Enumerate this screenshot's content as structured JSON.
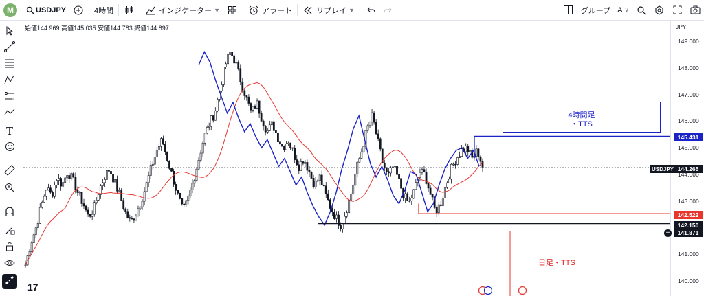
{
  "toolbar": {
    "avatar": "M",
    "symbol": "USDJPY",
    "timeframe": "4時間",
    "indicators": "インジケーター",
    "alert": "アラート",
    "replay": "リプレイ",
    "group": "グループ",
    "group_value": "A"
  },
  "legend": {
    "open_label": "始値",
    "open": "144.969",
    "high_label": "高値",
    "high": "145.035",
    "low_label": "安値",
    "low": "144.783",
    "close_label": "終値",
    "close": "144.897"
  },
  "axis": {
    "currency": "JPY",
    "ticks": [
      "149.000",
      "148.000",
      "147.000",
      "146.000",
      "145.000",
      "144.000",
      "143.000",
      "142.000",
      "141.000",
      "140.000"
    ]
  },
  "price_labels": {
    "tts_4h": "145.431",
    "current_symbol": "USDJPY",
    "current": "144.265",
    "tts_daily": "142.522",
    "support": "142.150",
    "crosshair": "141.871"
  },
  "annotations": {
    "box_4h_line1": "4時間足",
    "box_4h_line2": "・TTS",
    "daily": "日足・TTS"
  },
  "colors": {
    "up": "#131722",
    "down": "#131722",
    "ma_red": "#e8362f",
    "zigzag_blue": "#1a23c8",
    "line_red": "#e8362f",
    "line_blue": "#1a23c8"
  },
  "chart_data": {
    "type": "candlestick",
    "ylim": [
      139.75,
      149.55
    ],
    "price_levels": [
      {
        "name": "4時間足・TTS",
        "value": 145.431,
        "color": "#1a23c8"
      },
      {
        "name": "日足・TTS",
        "value": 142.522,
        "color": "#e8362f"
      },
      {
        "value": 142.15,
        "color": "#131722"
      },
      {
        "value": 144.265,
        "style": "dotted"
      }
    ],
    "close_path": [
      140.6,
      141.4,
      142.0,
      142.8,
      143.5,
      143.2,
      143.9,
      143.6,
      144.1,
      143.8,
      143.3,
      142.9,
      142.4,
      142.7,
      143.4,
      143.9,
      144.2,
      143.7,
      143.2,
      142.6,
      142.2,
      142.5,
      143.0,
      143.6,
      144.3,
      144.9,
      145.3,
      144.6,
      143.9,
      143.2,
      142.6,
      143.1,
      143.8,
      144.6,
      145.4,
      145.9,
      146.3,
      147.2,
      148.1,
      148.6,
      148.2,
      147.5,
      146.9,
      146.3,
      146.7,
      146.1,
      145.6,
      145.9,
      145.4,
      145.0,
      145.3,
      144.8,
      144.3,
      144.6,
      144.1,
      143.6,
      143.9,
      143.3,
      142.8,
      142.4,
      142.1,
      142.6,
      143.3,
      144.2,
      144.9,
      145.7,
      146.2,
      145.3,
      144.4,
      143.9,
      144.3,
      143.8,
      143.2,
      142.9,
      143.4,
      144.1,
      144.0,
      143.3,
      142.6,
      142.9,
      143.6,
      144.2,
      144.6,
      144.9,
      145.0,
      144.6,
      144.9,
      144.3
    ]
  }
}
